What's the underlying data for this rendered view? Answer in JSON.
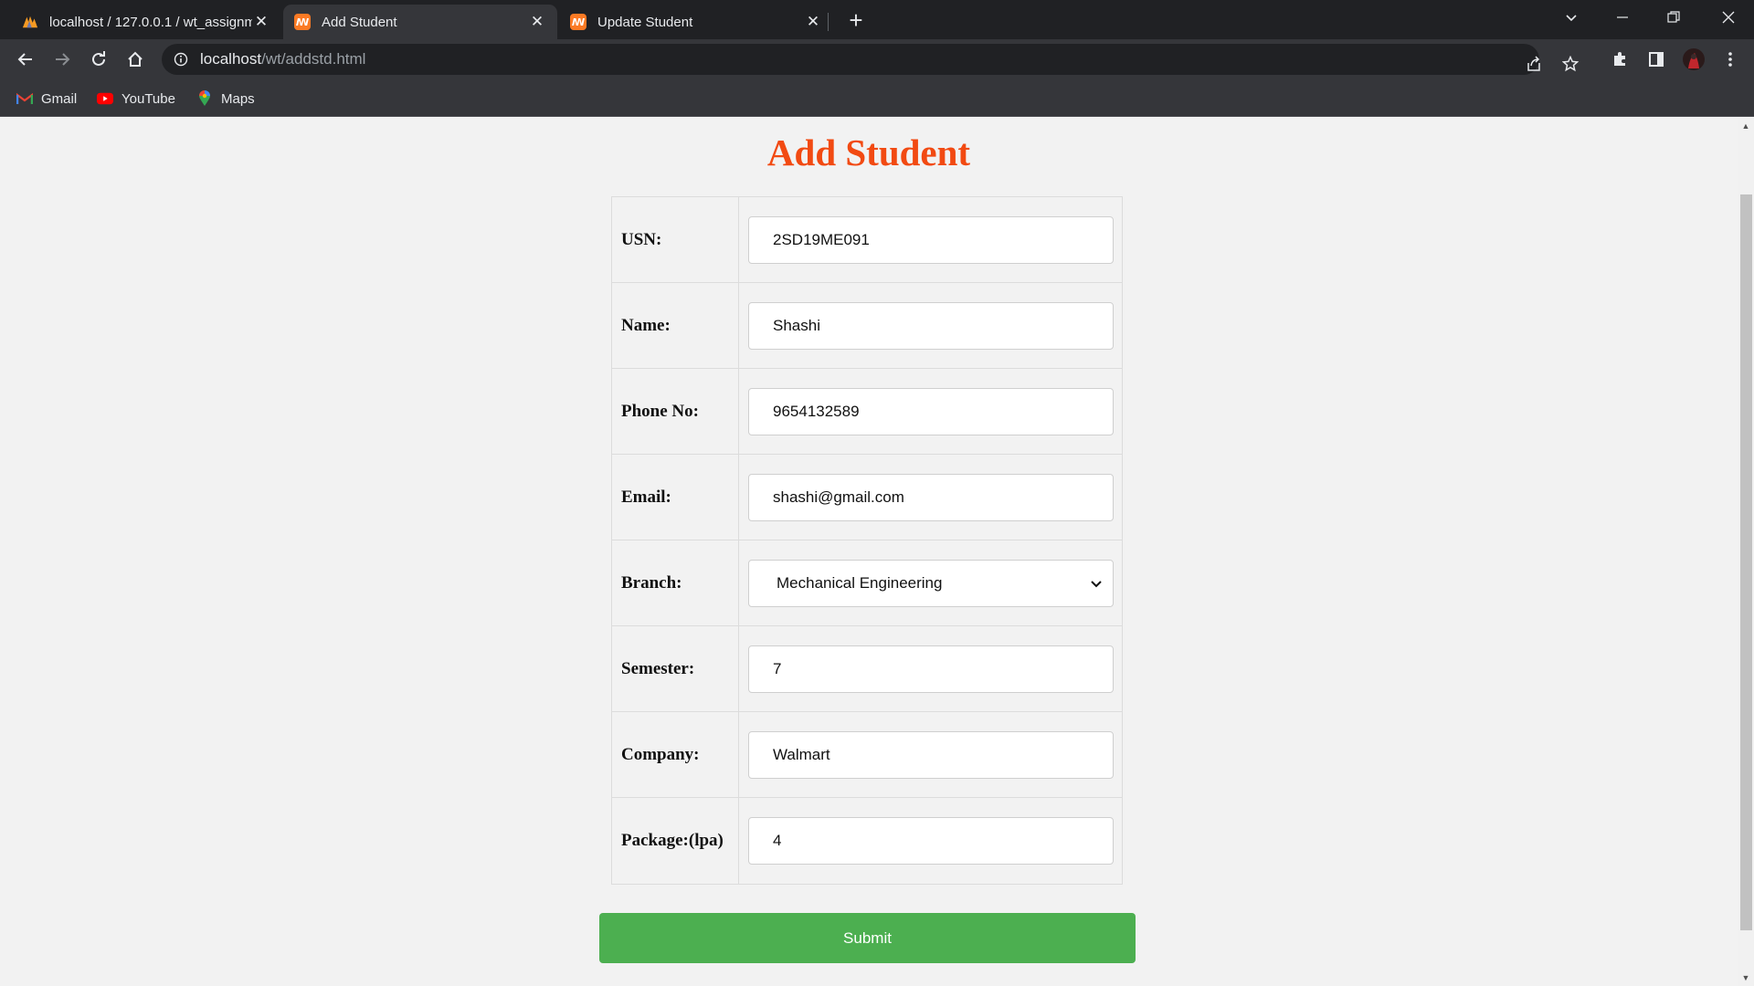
{
  "browser": {
    "tabs": [
      {
        "title": "localhost / 127.0.0.1 / wt_assignm",
        "active": false,
        "favicon": "phpmyadmin-icon"
      },
      {
        "title": "Add Student",
        "active": true,
        "favicon": "xampp-icon"
      },
      {
        "title": "Update Student",
        "active": false,
        "favicon": "xampp-icon"
      }
    ],
    "address": {
      "host": "localhost",
      "path": "/wt/addstd.html"
    },
    "bookmarks": [
      {
        "label": "Gmail",
        "icon": "gmail-icon"
      },
      {
        "label": "YouTube",
        "icon": "youtube-icon"
      },
      {
        "label": "Maps",
        "icon": "maps-icon"
      }
    ]
  },
  "page": {
    "title": "Add Student",
    "fields": [
      {
        "label": "USN:",
        "value": "2SD19ME091",
        "type": "text"
      },
      {
        "label": "Name:",
        "value": "Shashi",
        "type": "text"
      },
      {
        "label": "Phone No:",
        "value": "9654132589",
        "type": "text"
      },
      {
        "label": "Email:",
        "value": "shashi@gmail.com",
        "type": "text"
      },
      {
        "label": "Branch:",
        "value": "Mechanical Engineering",
        "type": "select"
      },
      {
        "label": "Semester:",
        "value": "7",
        "type": "text"
      },
      {
        "label": "Company:",
        "value": "Walmart",
        "type": "text"
      },
      {
        "label": "Package:(lpa)",
        "value": "4",
        "type": "text"
      }
    ],
    "submit_label": "Submit"
  },
  "colors": {
    "title": "#f24a12",
    "submit": "#4caf50",
    "chrome_dark": "#202124",
    "chrome_mid": "#35363a"
  }
}
